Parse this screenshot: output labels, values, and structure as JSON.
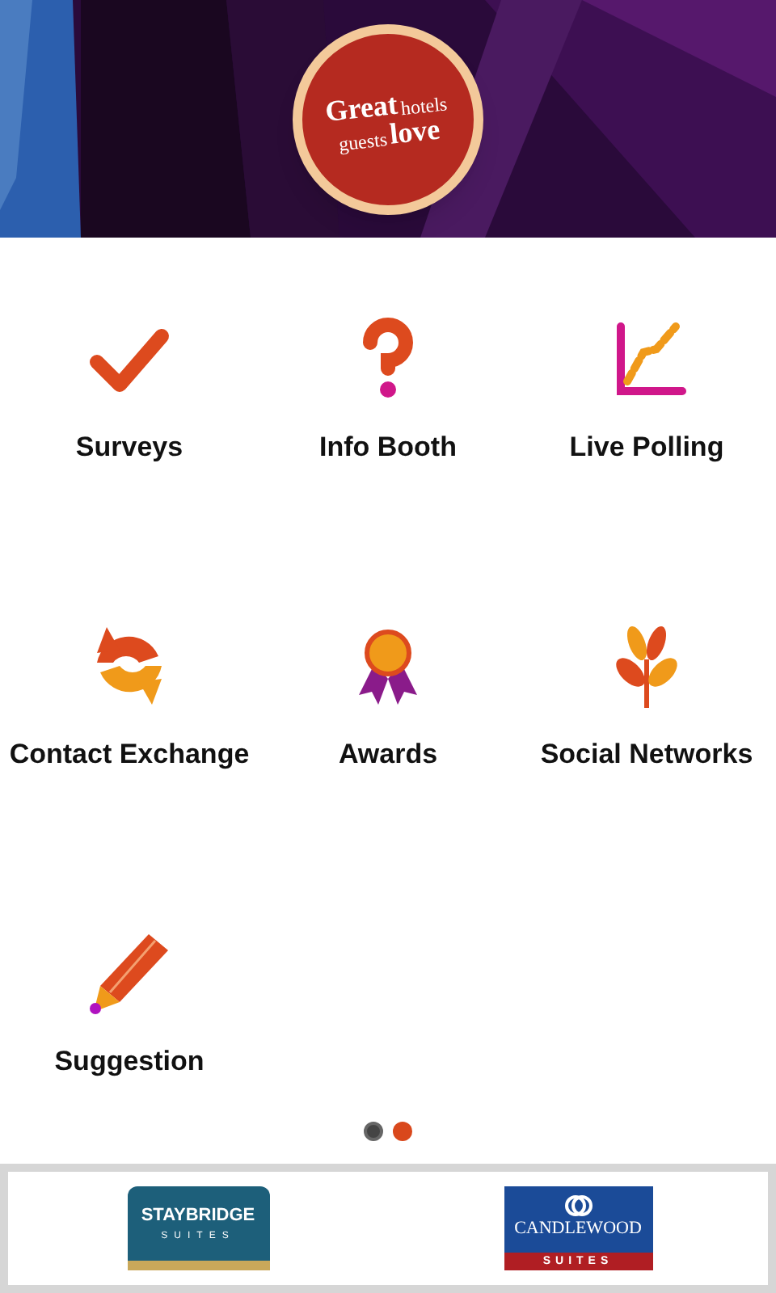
{
  "header": {
    "logo": {
      "words": [
        "Great",
        "hotels",
        "guests",
        "love"
      ]
    }
  },
  "tiles": [
    {
      "kind": "check",
      "label": "Surveys"
    },
    {
      "kind": "question",
      "label": "Info Booth"
    },
    {
      "kind": "chart",
      "label": "Live Polling"
    },
    {
      "kind": "exchange",
      "label": "Contact Exchange"
    },
    {
      "kind": "award",
      "label": "Awards"
    },
    {
      "kind": "plant",
      "label": "Social Networks"
    },
    {
      "kind": "pencil",
      "label": "Suggestion"
    }
  ],
  "pager": [
    {
      "selected": false
    },
    {
      "selected": true
    }
  ],
  "sponsors": [
    {
      "kind": "staybridge",
      "name": "STAYBRIDGE",
      "sub": "SUITES"
    },
    {
      "kind": "candlewood",
      "name": "CANDLEWOOD",
      "sub": "SUITES"
    }
  ]
}
